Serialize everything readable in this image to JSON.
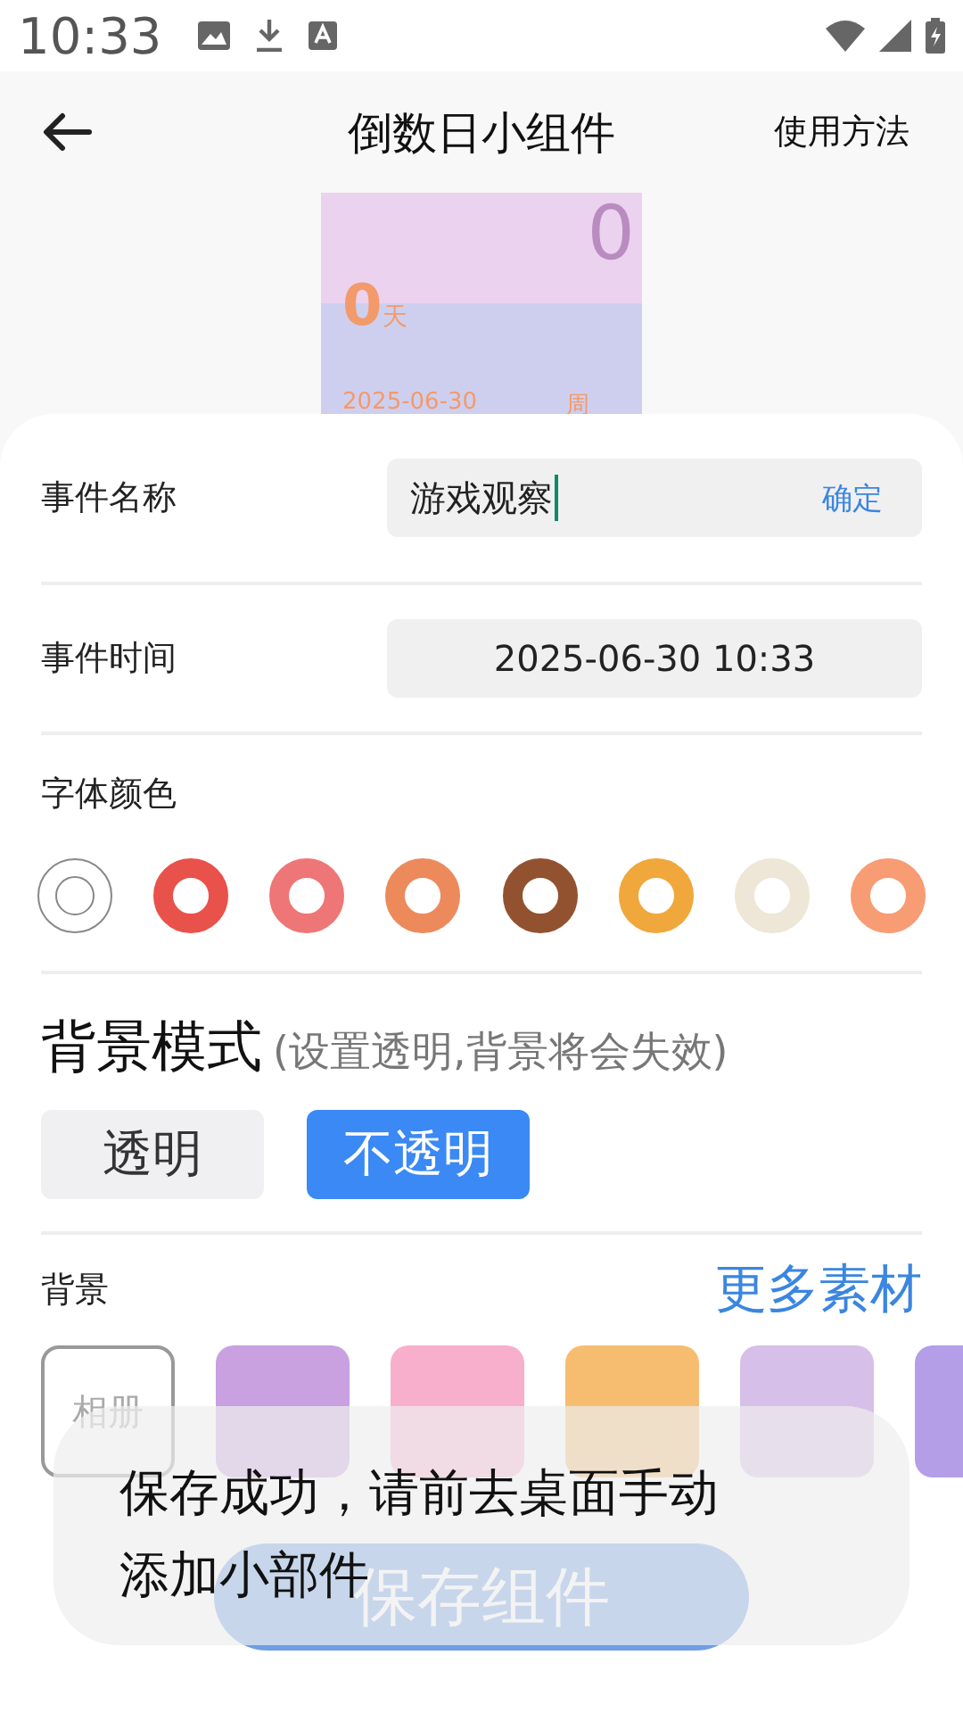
{
  "status_bar": {
    "time": "10:33"
  },
  "header": {
    "title": "倒数日小组件",
    "action": "使用方法"
  },
  "preview": {
    "big_number": "0",
    "days": "0",
    "days_unit": "天",
    "date": "2025-06-30",
    "weekday": "周"
  },
  "form": {
    "name_label": "事件名称",
    "name_value": "游戏观察",
    "confirm": "确定",
    "time_label": "事件时间",
    "time_value": "2025-06-30 10:33"
  },
  "font_color": {
    "label": "字体颜色",
    "swatches": [
      {
        "kind": "outline",
        "color": "#ffffff"
      },
      {
        "kind": "ring",
        "color": "#e9524a"
      },
      {
        "kind": "ring",
        "color": "#ef7676"
      },
      {
        "kind": "ring",
        "color": "#ec8a5c"
      },
      {
        "kind": "ring",
        "color": "#93522f"
      },
      {
        "kind": "ring",
        "color": "#f0a83c"
      },
      {
        "kind": "ring",
        "color": "#eee6d6"
      },
      {
        "kind": "ring",
        "color": "#f89c74"
      }
    ]
  },
  "background_mode": {
    "title": "背景模式",
    "hint": "(设置透明,背景将会失效)",
    "options": [
      {
        "label": "透明",
        "selected": false
      },
      {
        "label": "不透明",
        "selected": true
      }
    ]
  },
  "background": {
    "label": "背景",
    "more": "更多素材",
    "tiles": [
      {
        "kind": "album",
        "label": "相册"
      },
      {
        "kind": "gradient",
        "color": "#c9a0e0"
      },
      {
        "kind": "gradient",
        "color": "#f8afcb"
      },
      {
        "kind": "gradient",
        "color": "#f6bd70"
      },
      {
        "kind": "gradient",
        "color": "#d6bfe8"
      },
      {
        "kind": "gradient",
        "color": "#b49ee8"
      }
    ]
  },
  "save_button": "保存组件",
  "toast": "保存成功，请前去桌面手动添加小部件"
}
